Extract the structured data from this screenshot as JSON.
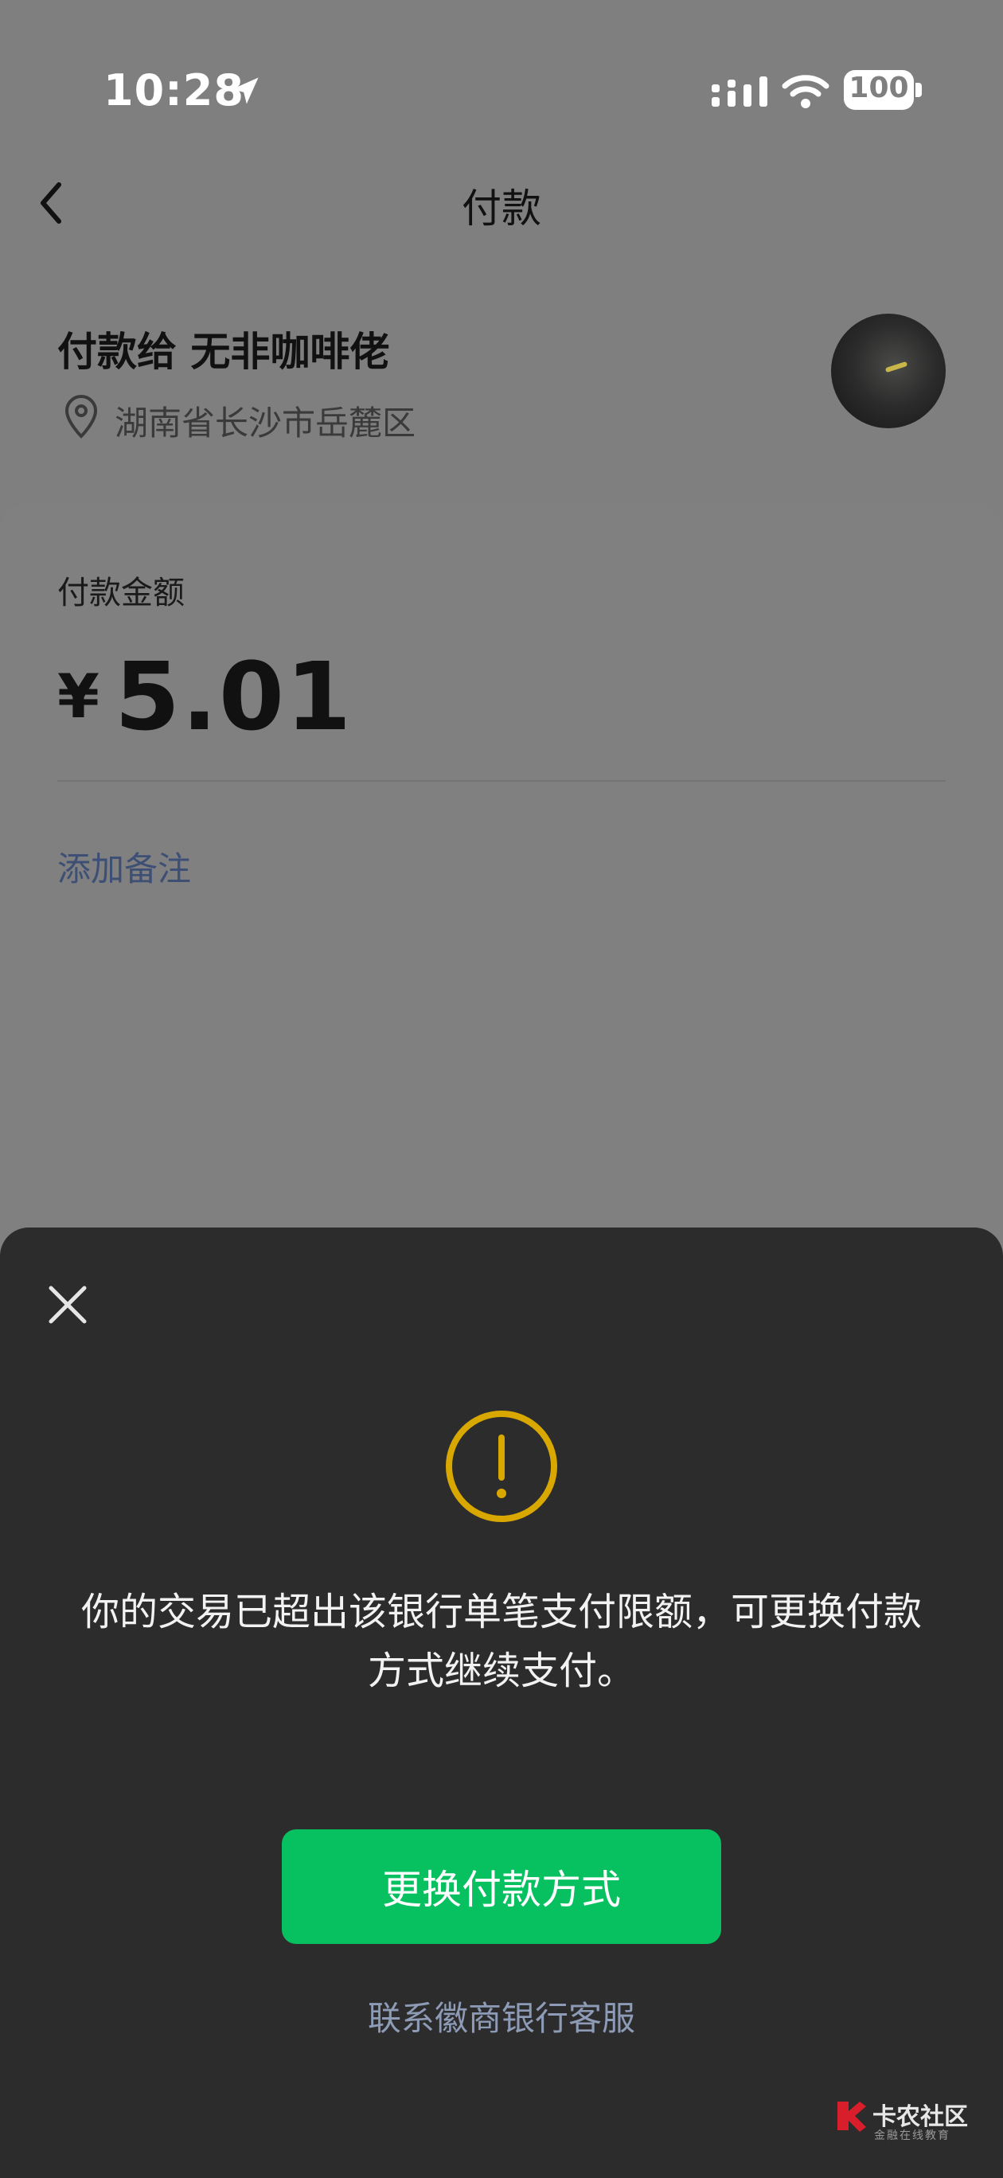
{
  "status_bar": {
    "time": "10:28",
    "battery": "100"
  },
  "nav": {
    "title": "付款"
  },
  "payee": {
    "name": "付款给 无非咖啡佬",
    "location": "湖南省长沙市岳麓区"
  },
  "payment": {
    "amount_label": "付款金额",
    "currency_symbol": "¥",
    "amount": "5.01",
    "remark_link": "添加备注"
  },
  "dialog": {
    "message": "你的交易已超出该银行单笔支付限额，可更换付款方式继续支付。",
    "primary_button": "更换付款方式",
    "secondary_link": "联系徽商银行客服"
  },
  "watermark": {
    "title": "卡农社区",
    "subtitle": "金融在线教育"
  },
  "colors": {
    "accent_green": "#07c160",
    "warning_yellow": "#d9a800",
    "link_blue": "#3d4f74"
  },
  "icons": [
    "location-arrow-icon",
    "signal-icon",
    "wifi-icon",
    "battery-icon",
    "back-chevron-icon",
    "location-pin-icon",
    "close-icon",
    "warning-icon"
  ]
}
